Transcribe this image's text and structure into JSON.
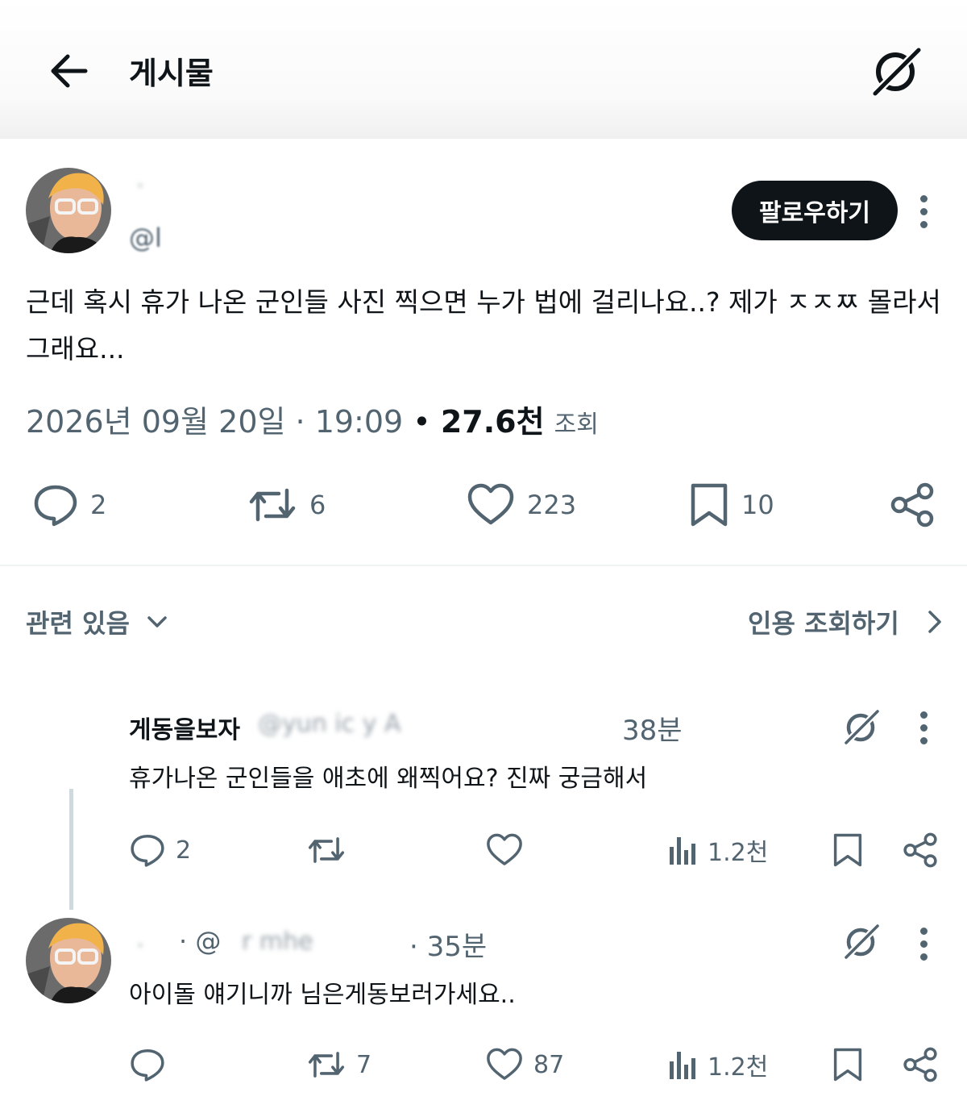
{
  "header": {
    "title": "게시물"
  },
  "post": {
    "author_name": "ㆍ",
    "handle": "@l ",
    "follow_label": "팔로우하기",
    "text": "근데 혹시 휴가 나온 군인들 사진 찍으면 누가 법에 걸리나요..? 제가 ㅈㅈㅉ 몰라서 그래요...",
    "date": "2026년 09월 20일 · 19:09",
    "dot": "•",
    "views": "27.6천",
    "views_label": "조회",
    "stats": {
      "replies": "2",
      "reposts": "6",
      "likes": "223",
      "bookmarks": "10"
    }
  },
  "related": {
    "label": "관련 있음",
    "quote_label": "인용 조회하기"
  },
  "replies": [
    {
      "name": "게동을보자",
      "handle_blur": "@yun ic y A",
      "time": "38분",
      "text": "휴가나온 군인들을 애초에 왜찍어요? 진짜 궁금해서",
      "stats": {
        "replies": "2",
        "views": "1.2천"
      }
    },
    {
      "name_blur": "ㆍ",
      "handle": "· @",
      "handle_blur": "r mhe",
      "time": "· 35분",
      "text": "아이돌 얘기니까 님은게동보러가세요..",
      "stats": {
        "reposts": "7",
        "likes": "87",
        "views": "1.2천"
      }
    }
  ],
  "colors": {
    "text": "#0f1419",
    "muted": "#536471",
    "divider": "#eff3f4",
    "thread": "#cfd9de"
  }
}
